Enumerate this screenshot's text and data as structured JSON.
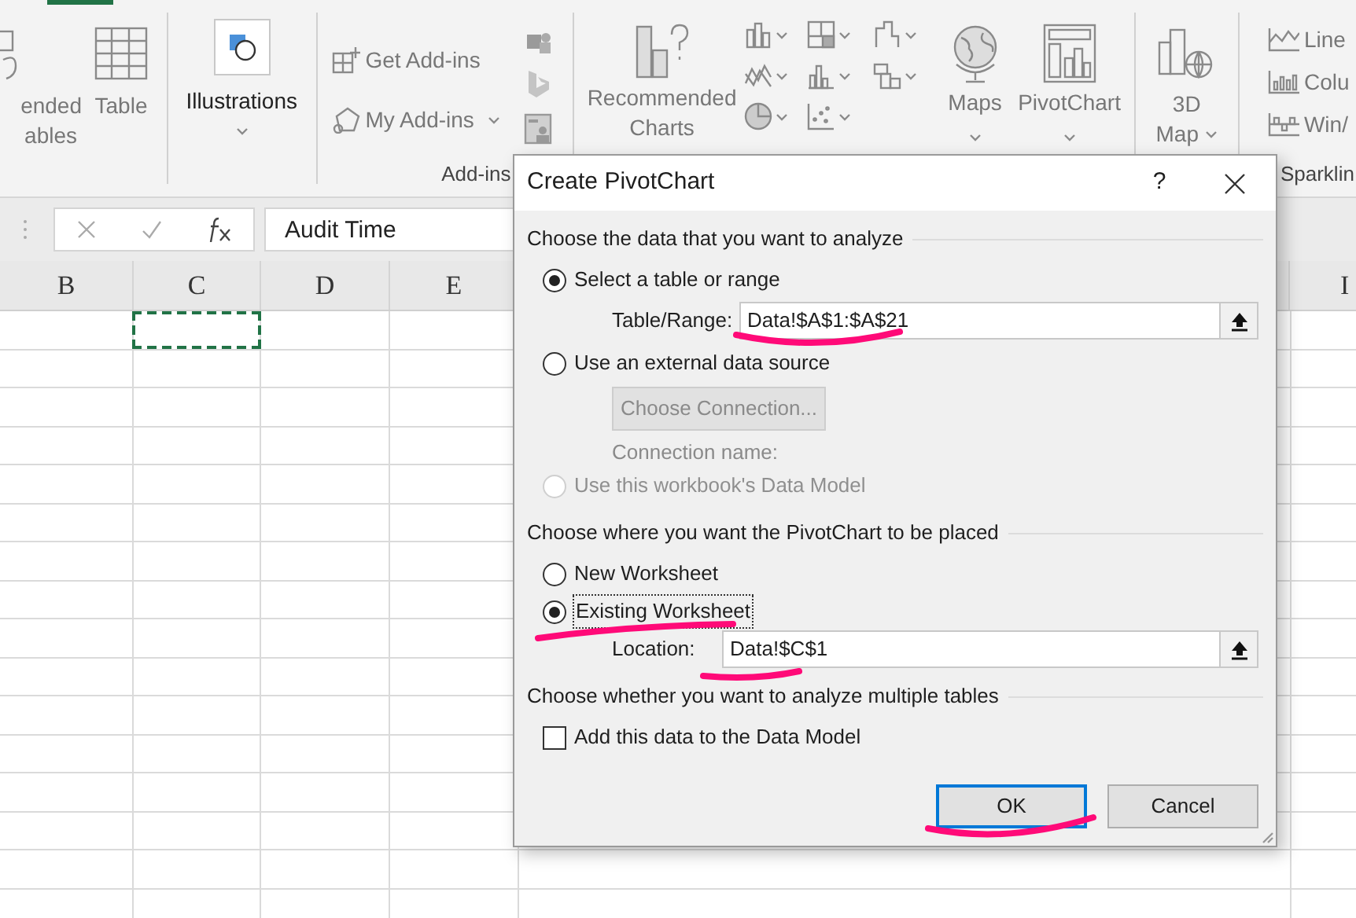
{
  "ribbon": {
    "cut_button": [
      "ended",
      "ables"
    ],
    "table_button": "Table",
    "illustrations_button": "Illustrations",
    "addins": {
      "get": "Get Add-ins",
      "mine": "My Add-ins",
      "group_label": "Add-ins"
    },
    "recommended_charts": [
      "Recommended",
      "Charts"
    ],
    "maps": "Maps",
    "pivotchart": "PivotChart",
    "map_3d": [
      "3D",
      "Map"
    ],
    "sparklines": [
      "Line",
      "Colu",
      "Win/"
    ],
    "sparklines_group_label": "Sparklin"
  },
  "formula_bar": {
    "value": "Audit Time"
  },
  "sheet": {
    "columns": [
      "B",
      "C",
      "D",
      "E"
    ],
    "right_column": "I",
    "copy_marquee": true
  },
  "dialog": {
    "title": "Create PivotChart",
    "help": "?",
    "source_heading": "Choose the data that you want to analyze",
    "source_options": [
      {
        "label": "Select a table or range",
        "selected": true,
        "disabled": false
      },
      {
        "label": "Use an external data source",
        "selected": false,
        "disabled": false
      },
      {
        "label": "Use this workbook's Data Model",
        "selected": false,
        "disabled": true
      }
    ],
    "range_label": "Table/Range:",
    "range_value": "Data!$A$1:$A$21",
    "connection_button": "Choose Connection...",
    "connection_label": "Connection name:",
    "placement_heading": "Choose where you want the PivotChart to be placed",
    "placement_options": [
      {
        "label": "New Worksheet",
        "selected": false
      },
      {
        "label": "Existing Worksheet",
        "selected": true
      }
    ],
    "location_label": "Location:",
    "location_value": "Data!$C$1",
    "tables_heading": "Choose whether you want to analyze multiple tables",
    "data_model_checkbox": {
      "label": "Add this data to the Data Model",
      "checked": false
    },
    "buttons": [
      {
        "label": "OK",
        "default": true
      },
      {
        "label": "Cancel",
        "default": false
      }
    ]
  }
}
